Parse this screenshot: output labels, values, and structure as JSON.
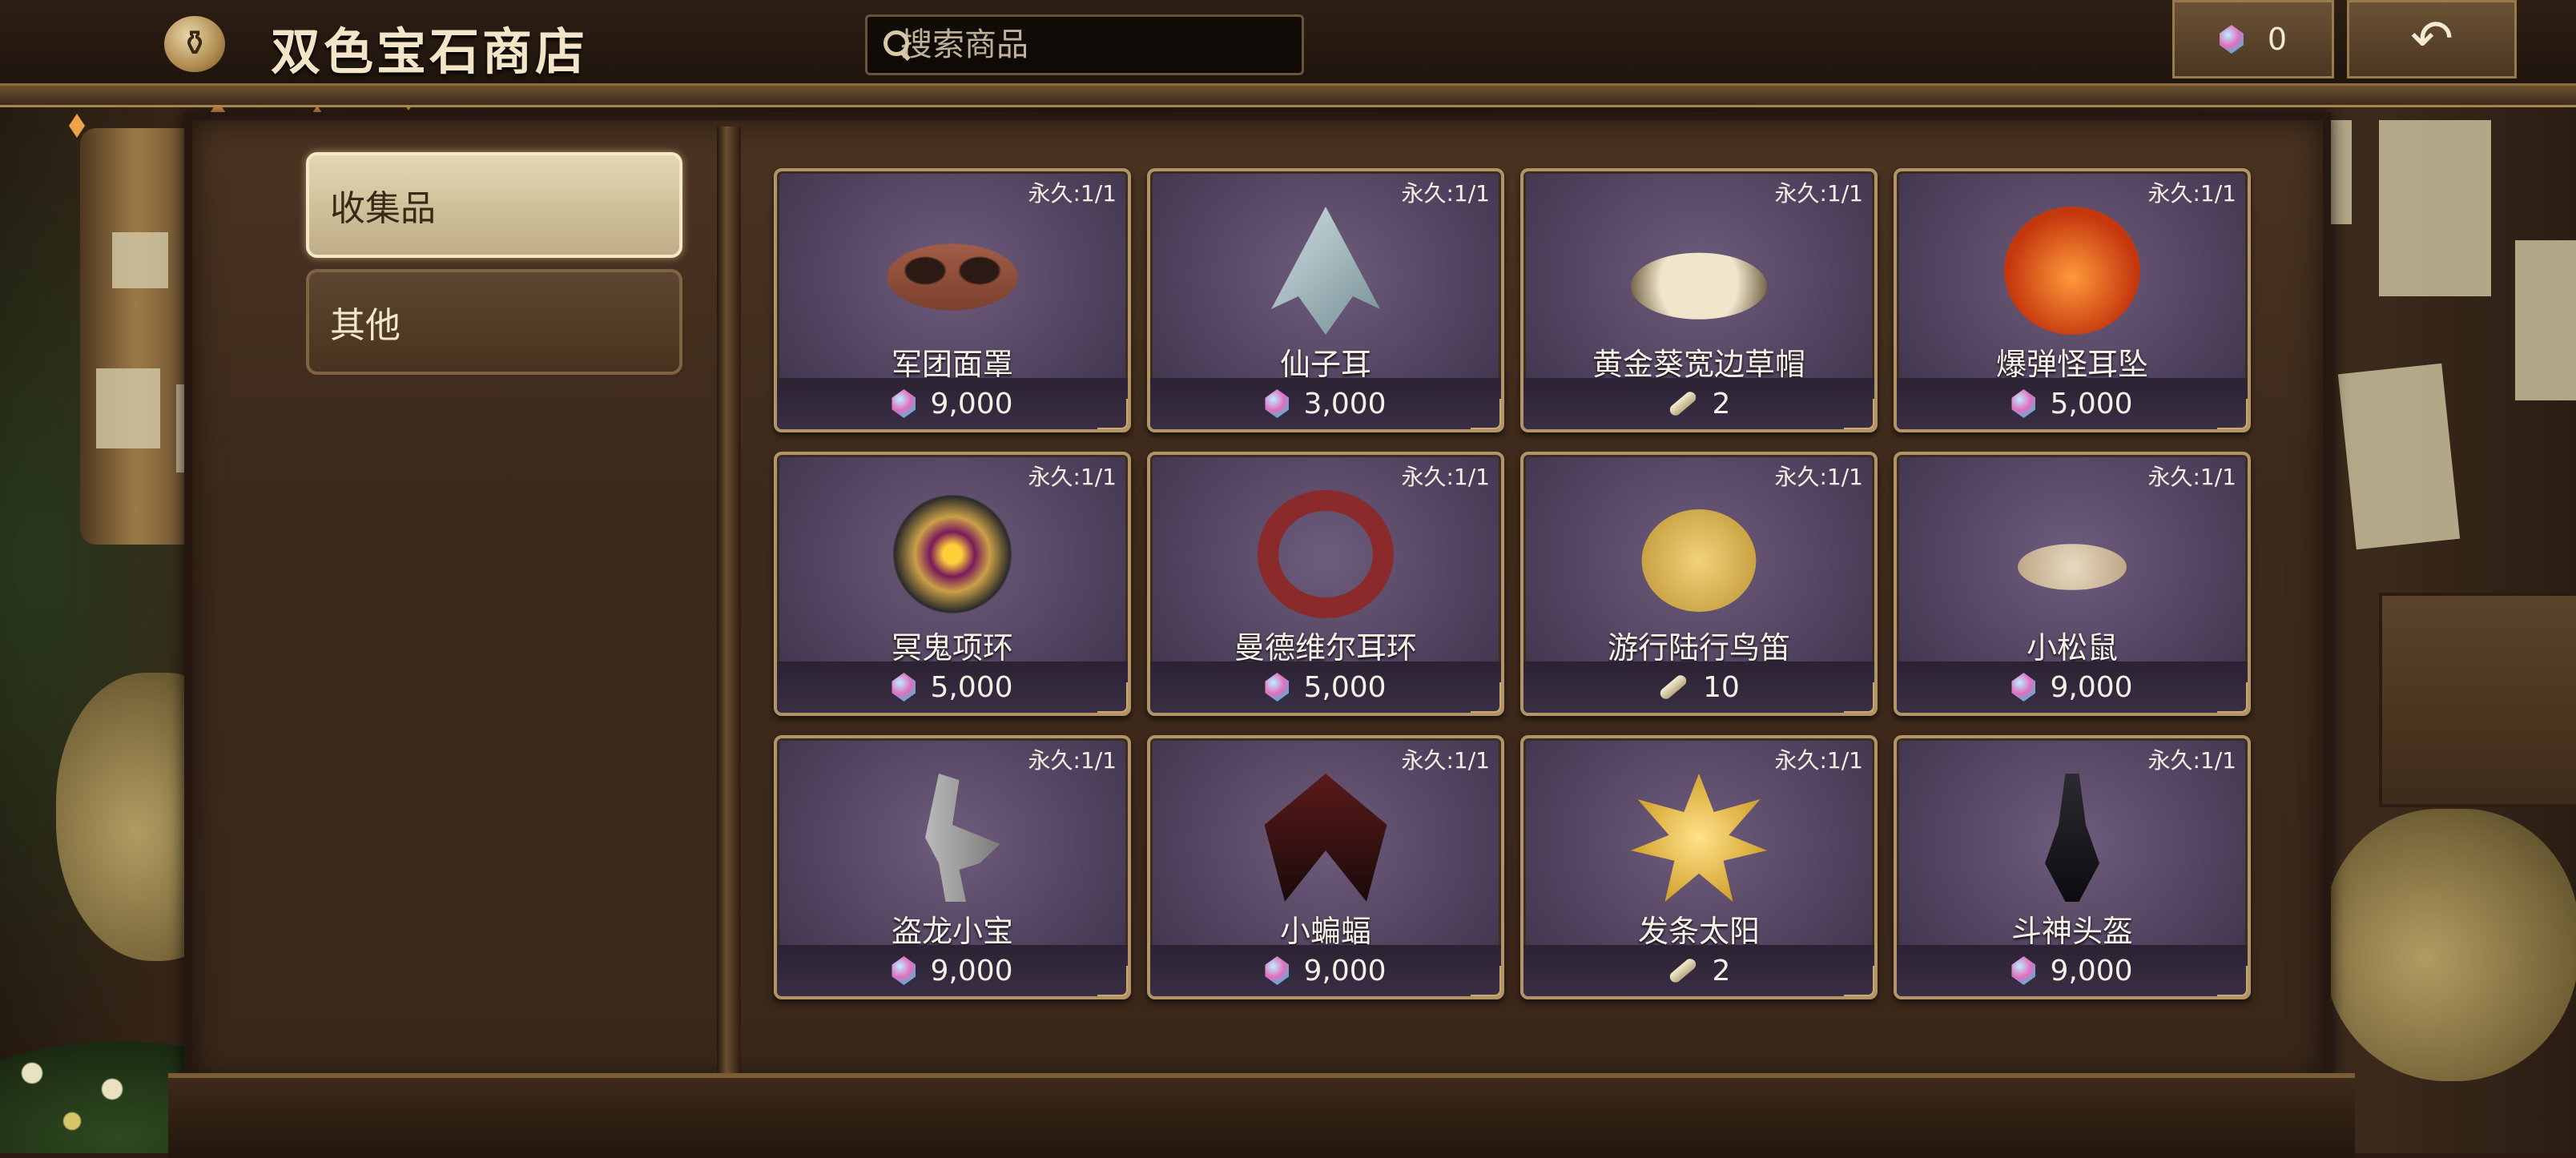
{
  "header": {
    "title": "双色宝石商店",
    "search_placeholder": "搜索商品",
    "gem_balance": "0"
  },
  "sidebar": {
    "tabs": [
      {
        "label": "收集品",
        "active": true
      },
      {
        "label": "其他",
        "active": false
      }
    ]
  },
  "items": [
    {
      "name": "军团面罩",
      "limit": "永久:1/1",
      "price": "9,000",
      "currency": "gem",
      "icon": "mask-icon"
    },
    {
      "name": "仙子耳",
      "limit": "永久:1/1",
      "price": "3,000",
      "currency": "gem",
      "icon": "fairy-ear-icon"
    },
    {
      "name": "黄金葵宽边草帽",
      "limit": "永久:1/1",
      "price": "2",
      "currency": "scroll",
      "icon": "straw-hat-icon"
    },
    {
      "name": "爆弹怪耳坠",
      "limit": "永久:1/1",
      "price": "5,000",
      "currency": "gem",
      "icon": "bomb-earring-icon"
    },
    {
      "name": "冥鬼项环",
      "limit": "永久:1/1",
      "price": "5,000",
      "currency": "gem",
      "icon": "collar-icon"
    },
    {
      "name": "曼德维尔耳环",
      "limit": "永久:1/1",
      "price": "5,000",
      "currency": "gem",
      "icon": "earring-icon"
    },
    {
      "name": "游行陆行鸟笛",
      "limit": "永久:1/1",
      "price": "10",
      "currency": "scroll",
      "icon": "bird-whistle-icon"
    },
    {
      "name": "小松鼠",
      "limit": "永久:1/1",
      "price": "9,000",
      "currency": "gem",
      "icon": "mouse-icon"
    },
    {
      "name": "盗龙小宝",
      "limit": "永久:1/1",
      "price": "9,000",
      "currency": "gem",
      "icon": "raptor-icon"
    },
    {
      "name": "小蝙蝠",
      "limit": "永久:1/1",
      "price": "9,000",
      "currency": "gem",
      "icon": "bat-icon"
    },
    {
      "name": "发条太阳",
      "limit": "永久:1/1",
      "price": "2",
      "currency": "scroll",
      "icon": "sun-icon"
    },
    {
      "name": "斗神头盔",
      "limit": "永久:1/1",
      "price": "9,000",
      "currency": "gem",
      "icon": "helmet-icon"
    }
  ],
  "colors": {
    "card_bg": "#4a3d58",
    "card_border": "#b29468",
    "active_tab": "#e4d6b2",
    "title_text": "#f3e6c8"
  }
}
